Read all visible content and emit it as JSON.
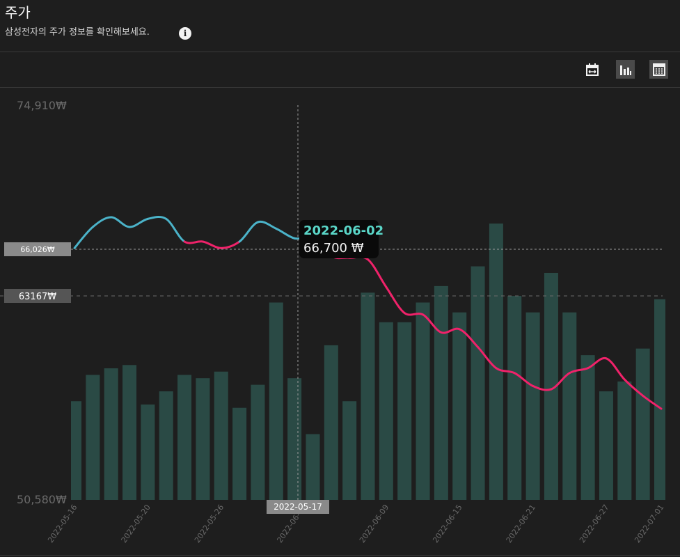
{
  "header": {
    "title": "주가",
    "subtitle": "삼성전자의 주가 정보를 확인해보세요.",
    "info_icon": "info-icon"
  },
  "toolbar": [
    {
      "name": "date-range-button",
      "icon": "calendar-range-icon",
      "active": false
    },
    {
      "name": "bar-chart-button",
      "icon": "bar-chart-icon",
      "active": true
    },
    {
      "name": "table-view-button",
      "icon": "grid-icon",
      "active": true
    }
  ],
  "colors": {
    "line_up": "#4bb3c9",
    "line_down": "#f0226a",
    "bars": "#2a4a45",
    "tooltip_date": "#5ad6c8",
    "tooltip_bg": "#0a0a0a"
  },
  "tooltip": {
    "date": "2022-06-02",
    "value": "66,700 ₩"
  },
  "crosshair_label": "66,026₩",
  "avg_label": "63167₩",
  "crosshair_x_label": "2022-05-17",
  "chart_data": {
    "type": "line",
    "title": "",
    "ylim": [
      50580,
      74910
    ],
    "y_tick_labels": [
      "74,910₩",
      "50,580₩"
    ],
    "x_tick_labels": [
      "2022-05-16",
      "2022-05-20",
      "2022-05-26",
      "2022-06-03",
      "2022-06-09",
      "2022-06-15",
      "2022-06-21",
      "2022-06-27",
      "2022-07-01"
    ],
    "x": [
      "2022-05-16",
      "2022-05-17",
      "2022-05-18",
      "2022-05-19",
      "2022-05-20",
      "2022-05-23",
      "2022-05-24",
      "2022-05-25",
      "2022-05-26",
      "2022-05-27",
      "2022-05-30",
      "2022-05-31",
      "2022-06-02",
      "2022-06-03",
      "2022-06-07",
      "2022-06-08",
      "2022-06-09",
      "2022-06-10",
      "2022-06-13",
      "2022-06-14",
      "2022-06-15",
      "2022-06-16",
      "2022-06-17",
      "2022-06-20",
      "2022-06-21",
      "2022-06-22",
      "2022-06-23",
      "2022-06-24",
      "2022-06-27",
      "2022-06-28",
      "2022-06-29",
      "2022-06-30",
      "2022-07-01"
    ],
    "series": [
      {
        "values": [
          66100,
          67400,
          68000,
          67400,
          67900,
          67900,
          66500,
          66500,
          66100,
          66500,
          67700,
          67300,
          66700,
          66700,
          65600,
          65500,
          65400,
          63700,
          62100,
          62000,
          60900,
          61100,
          60000,
          58700,
          58400,
          57600,
          57400,
          58400,
          58700,
          59300,
          58000,
          57000,
          56200
        ]
      },
      {
        "values": [
          3.0,
          3.8,
          4.0,
          4.1,
          2.9,
          3.3,
          3.8,
          3.7,
          3.9,
          2.8,
          3.5,
          6.0,
          3.7,
          2.0,
          4.7,
          3.0,
          6.3,
          5.4,
          5.4,
          6.0,
          6.5,
          5.7,
          7.1,
          8.4,
          6.2,
          5.7,
          6.9,
          5.7,
          4.4,
          3.3,
          3.6,
          4.6,
          6.1
        ]
      }
    ],
    "avg": 63167,
    "grid": false,
    "legend": "none"
  }
}
